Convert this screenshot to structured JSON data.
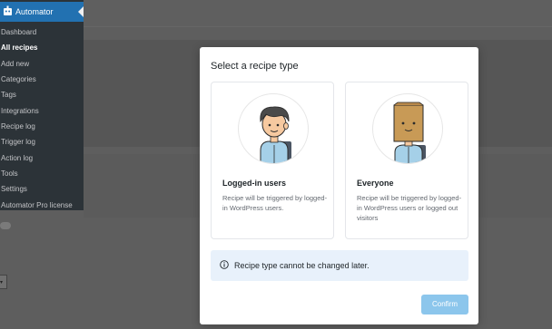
{
  "sidebar": {
    "title": "Automator",
    "items": [
      {
        "label": "Dashboard",
        "active": false
      },
      {
        "label": "All recipes",
        "active": true
      },
      {
        "label": "Add new",
        "active": false
      },
      {
        "label": "Categories",
        "active": false
      },
      {
        "label": "Tags",
        "active": false
      },
      {
        "label": "Integrations",
        "active": false
      },
      {
        "label": "Recipe log",
        "active": false
      },
      {
        "label": "Trigger log",
        "active": false
      },
      {
        "label": "Action log",
        "active": false
      },
      {
        "label": "Tools",
        "active": false
      },
      {
        "label": "Settings",
        "active": false
      },
      {
        "label": "Automator Pro license",
        "active": false
      }
    ]
  },
  "modal": {
    "title": "Select a recipe type",
    "cards": [
      {
        "icon": "user-avatar-icon",
        "title": "Logged-in users",
        "description": "Recipe will be triggered by logged-in WordPress users."
      },
      {
        "icon": "bag-head-user-icon",
        "title": "Everyone",
        "description": "Recipe will be triggered by logged-in WordPress users or logged out visitors"
      }
    ],
    "notice": {
      "icon": "info-icon",
      "text": "Recipe type cannot be changed later."
    },
    "confirm_label": "Confirm"
  },
  "colors": {
    "sidebar_bg": "#2c3338",
    "sidebar_active": "#2271b1",
    "notice_bg": "#e8f1fb",
    "confirm_bg": "#8cc6ec"
  }
}
